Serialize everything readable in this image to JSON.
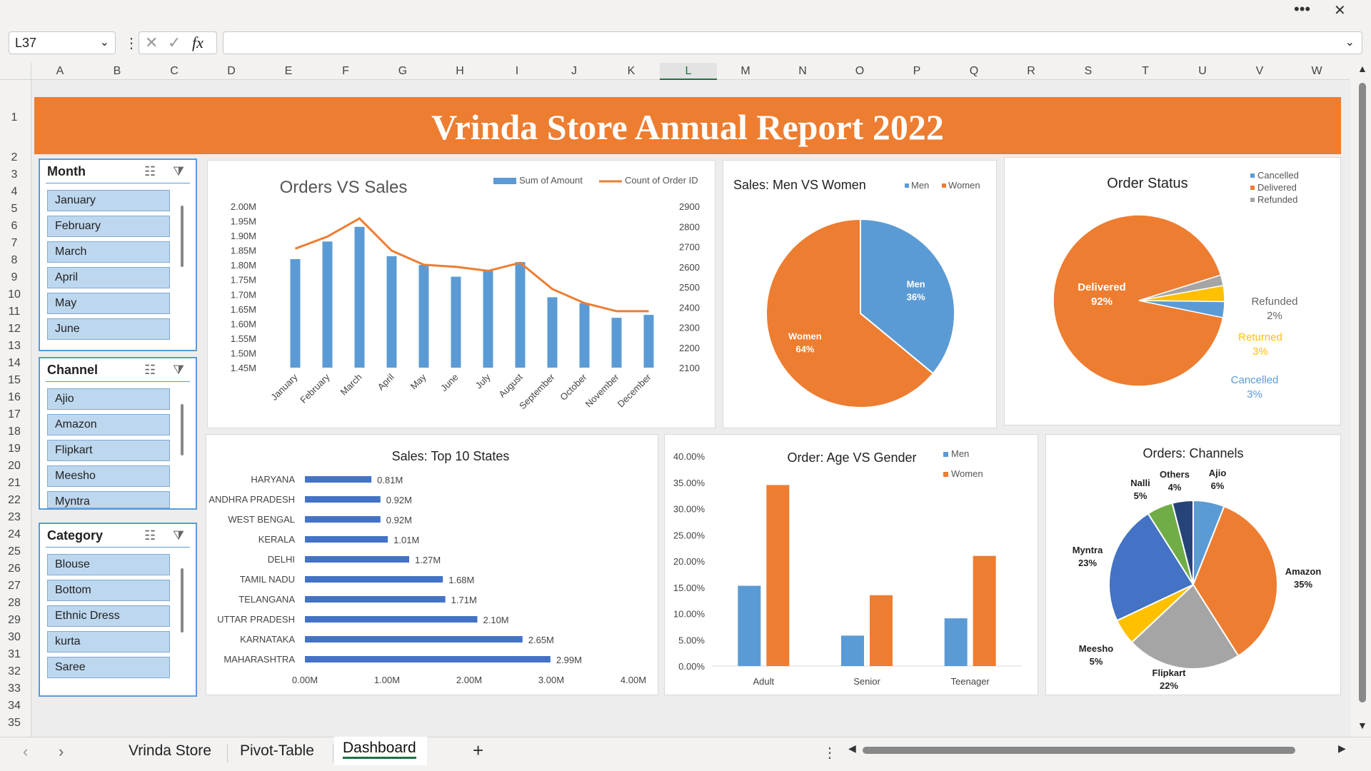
{
  "window": {
    "more_icon": "more-dots-icon",
    "close_icon": "close-icon"
  },
  "formula_bar": {
    "name_box": "L37",
    "formula": ""
  },
  "columns": [
    "A",
    "B",
    "C",
    "D",
    "E",
    "F",
    "G",
    "H",
    "I",
    "J",
    "K",
    "L",
    "M",
    "N",
    "O",
    "P",
    "Q",
    "R",
    "S",
    "T",
    "U",
    "V",
    "W"
  ],
  "selected_column": "L",
  "rows": [
    "1",
    "2",
    "3",
    "4",
    "5",
    "6",
    "7",
    "8",
    "9",
    "10",
    "11",
    "12",
    "13",
    "14",
    "15",
    "16",
    "17",
    "18",
    "19",
    "20",
    "21",
    "22",
    "23",
    "24",
    "25",
    "26",
    "27",
    "28",
    "29",
    "30",
    "31",
    "32",
    "33",
    "34",
    "35"
  ],
  "banner": {
    "title": "Vrinda Store Annual Report 2022",
    "color": "#ed7d31"
  },
  "slicers": {
    "month": {
      "title": "Month",
      "items": [
        "January",
        "February",
        "March",
        "April",
        "May",
        "June"
      ]
    },
    "channel": {
      "title": "Channel",
      "items": [
        "Ajio",
        "Amazon",
        "Flipkart",
        "Meesho",
        "Myntra"
      ]
    },
    "category": {
      "title": "Category",
      "items": [
        "Blouse",
        "Bottom",
        "Ethnic Dress",
        "kurta",
        "Saree"
      ]
    }
  },
  "chart_data": [
    {
      "type": "bar+line",
      "title": "Orders VS Sales",
      "categories": [
        "January",
        "February",
        "March",
        "April",
        "May",
        "June",
        "July",
        "August",
        "September",
        "October",
        "November",
        "December"
      ],
      "series": [
        {
          "name": "Sum of Amount",
          "type": "bar",
          "color": "#5b9bd5",
          "axis": "left",
          "values": [
            1.82,
            1.88,
            1.93,
            1.83,
            1.8,
            1.76,
            1.78,
            1.81,
            1.69,
            1.67,
            1.62,
            1.63
          ]
        },
        {
          "name": "Count of Order ID",
          "type": "line",
          "color": "#ed7d31",
          "axis": "right",
          "values": [
            2690,
            2750,
            2840,
            2680,
            2610,
            2600,
            2580,
            2620,
            2490,
            2420,
            2380,
            2380
          ]
        }
      ],
      "left_ticks": [
        "2.00M",
        "1.95M",
        "1.90M",
        "1.85M",
        "1.80M",
        "1.75M",
        "1.70M",
        "1.65M",
        "1.60M",
        "1.55M",
        "1.50M",
        "1.45M"
      ],
      "right_ticks": [
        "2900",
        "2800",
        "2700",
        "2600",
        "2500",
        "2400",
        "2300",
        "2200",
        "2100"
      ],
      "ylim_left": [
        1.45,
        2.0
      ],
      "ylim_right": [
        2100,
        2900
      ]
    },
    {
      "type": "pie",
      "title": "Sales: Men VS Women",
      "legend": [
        "Men",
        "Women"
      ],
      "slices": [
        {
          "name": "Men",
          "value": 36,
          "label": "36%",
          "color": "#5b9bd5"
        },
        {
          "name": "Women",
          "value": 64,
          "label": "64%",
          "color": "#ed7d31"
        }
      ]
    },
    {
      "type": "pie",
      "title": "Order Status",
      "legend": [
        "Cancelled",
        "Delivered",
        "Refunded"
      ],
      "slices": [
        {
          "name": "Delivered",
          "value": 92,
          "label": "92%",
          "color": "#ed7d31"
        },
        {
          "name": "Refunded",
          "value": 2,
          "label": "2%",
          "color": "#a5a5a5"
        },
        {
          "name": "Returned",
          "value": 3,
          "label": "3%",
          "color": "#ffc000"
        },
        {
          "name": "Cancelled",
          "value": 3,
          "label": "3%",
          "color": "#5b9bd5"
        }
      ]
    },
    {
      "type": "bar",
      "title": "Sales: Top 10 States",
      "categories": [
        "HARYANA",
        "ANDHRA PRADESH",
        "WEST BENGAL",
        "KERALA",
        "DELHI",
        "TAMIL NADU",
        "TELANGANA",
        "UTTAR PRADESH",
        "KARNATAKA",
        "MAHARASHTRA"
      ],
      "values": [
        0.81,
        0.92,
        0.92,
        1.01,
        1.27,
        1.68,
        1.71,
        2.1,
        2.65,
        2.99
      ],
      "labels": [
        "0.81M",
        "0.92M",
        "0.92M",
        "1.01M",
        "1.27M",
        "1.68M",
        "1.71M",
        "2.10M",
        "2.65M",
        "2.99M"
      ],
      "x_ticks": [
        "0.00M",
        "1.00M",
        "2.00M",
        "3.00M",
        "4.00M"
      ],
      "xlim": [
        0,
        4
      ],
      "color": "#4472c4"
    },
    {
      "type": "bar",
      "title": "Order: Age VS Gender",
      "categories": [
        "Adult",
        "Senior",
        "Teenager"
      ],
      "series": [
        {
          "name": "Men",
          "color": "#5b9bd5",
          "values": [
            15.3,
            5.8,
            9.1
          ]
        },
        {
          "name": "Women",
          "color": "#ed7d31",
          "values": [
            34.5,
            13.5,
            21.0
          ]
        }
      ],
      "y_ticks": [
        "40.00%",
        "35.00%",
        "30.00%",
        "25.00%",
        "20.00%",
        "15.00%",
        "10.00%",
        "5.00%",
        "0.00%"
      ],
      "ylim": [
        0,
        40
      ]
    },
    {
      "type": "pie",
      "title": "Orders: Channels",
      "slices": [
        {
          "name": "Ajio",
          "value": 6,
          "label": "6%",
          "color": "#5b9bd5"
        },
        {
          "name": "Amazon",
          "value": 35,
          "label": "35%",
          "color": "#ed7d31"
        },
        {
          "name": "Flipkart",
          "value": 22,
          "label": "22%",
          "color": "#a5a5a5"
        },
        {
          "name": "Meesho",
          "value": 5,
          "label": "5%",
          "color": "#ffc000"
        },
        {
          "name": "Myntra",
          "value": 23,
          "label": "23%",
          "color": "#4472c4"
        },
        {
          "name": "Nalli",
          "value": 5,
          "label": "5%",
          "color": "#70ad47"
        },
        {
          "name": "Others",
          "value": 4,
          "label": "4%",
          "color": "#264478"
        }
      ]
    }
  ],
  "sheet_tabs": [
    "Vrinda Store",
    "Pivot-Table",
    "Dashboard"
  ],
  "active_tab": "Dashboard",
  "add_sheet": "+"
}
